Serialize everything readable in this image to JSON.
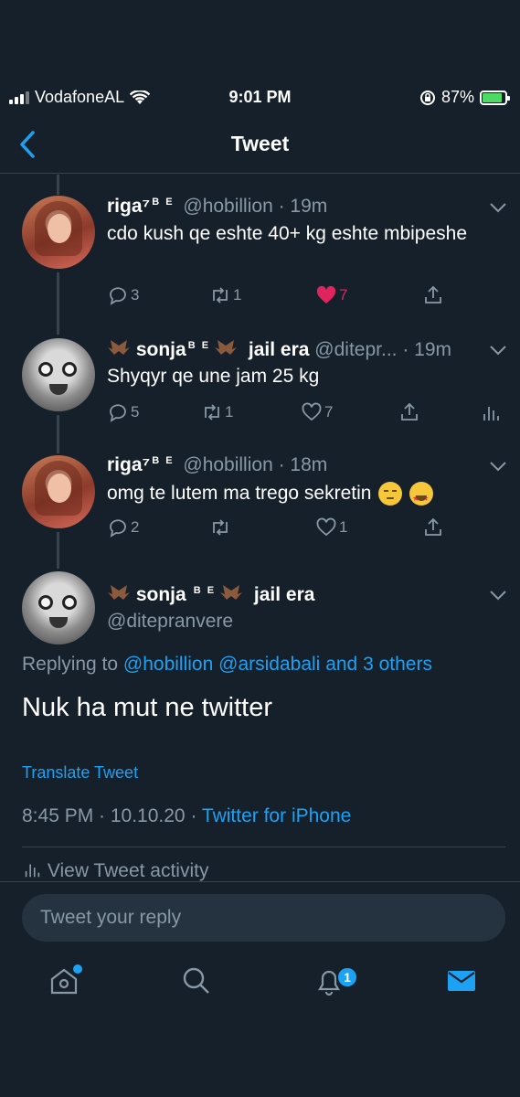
{
  "status_bar": {
    "carrier": "VodafoneAL",
    "time": "9:01 PM",
    "battery": "87%",
    "battery_level": 0.87,
    "icons": [
      "signal-icon",
      "wifi-icon",
      "orientation-lock-icon",
      "battery-charging-icon"
    ]
  },
  "nav": {
    "title": "Tweet",
    "back_icon": "chevron-left-icon"
  },
  "tweets": [
    {
      "name": "riga⁷",
      "badge": "B E",
      "handle": "@hobillion",
      "time": "· 19m",
      "text": "cdo kush qe eshte 40+ kg eshte mbipeshe",
      "replies": "3",
      "retweets": "1",
      "likes": "7",
      "liked": true
    },
    {
      "name": "sonja",
      "badge": "B E",
      "suffix": "jail era",
      "handle": "@ditepr...",
      "time": "· 19m",
      "text": "Shyqyr qe une jam 25 kg",
      "replies": "5",
      "retweets": "1",
      "likes": "7",
      "liked": false
    },
    {
      "name": "riga⁷",
      "badge": "B E",
      "handle": "@hobillion",
      "time": "· 18m",
      "text": "omg te lutem ma trego sekretin",
      "emojis": [
        "pensive-face-emoji",
        "star-struck-emoji"
      ],
      "replies": "2",
      "retweets": "",
      "likes": "1",
      "liked": false
    }
  ],
  "main_tweet": {
    "name": "sonja",
    "badge": "B E",
    "suffix": "jail era",
    "handle": "@ditepranvere",
    "replying_prefix": "Replying to",
    "replying_1": "@hobillion",
    "replying_2": "@arsidabali",
    "replying_rest": "and 3 others",
    "text": "Nuk ha mut ne twitter",
    "translate": "Translate Tweet",
    "timestamp": "8:45 PM · 10.10.20 ·",
    "source": "Twitter for iPhone",
    "activity": "View Tweet activity"
  },
  "reply": {
    "placeholder": "Tweet your reply"
  },
  "tabbar": {
    "notifications_badge": "1",
    "icons": [
      "home-icon",
      "search-icon",
      "notifications-icon",
      "messages-icon"
    ]
  },
  "colors": {
    "background": "#15202b",
    "accent": "#1da1f2",
    "like": "#e0245e",
    "secondary_text": "#8899a6"
  }
}
